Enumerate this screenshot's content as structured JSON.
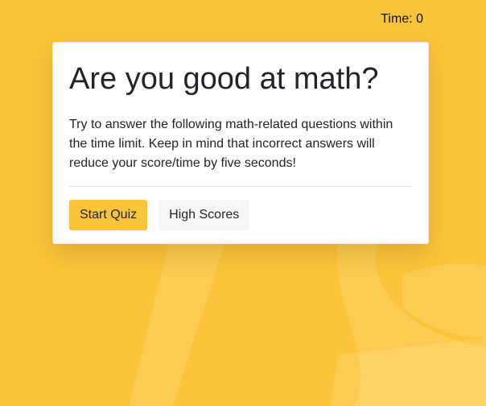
{
  "header": {
    "timer_label": "Time: 0"
  },
  "card": {
    "title": "Are you good at math?",
    "description": "Try to answer the following math-related questions within the time limit. Keep in mind that incorrect answers will reduce your score/time by five seconds!",
    "start_label": "Start Quiz",
    "scores_label": "High Scores"
  },
  "colors": {
    "background": "#fcc43a",
    "accent": "#fcc43a",
    "card": "#ffffff",
    "secondary_button": "#f6f6f6"
  }
}
